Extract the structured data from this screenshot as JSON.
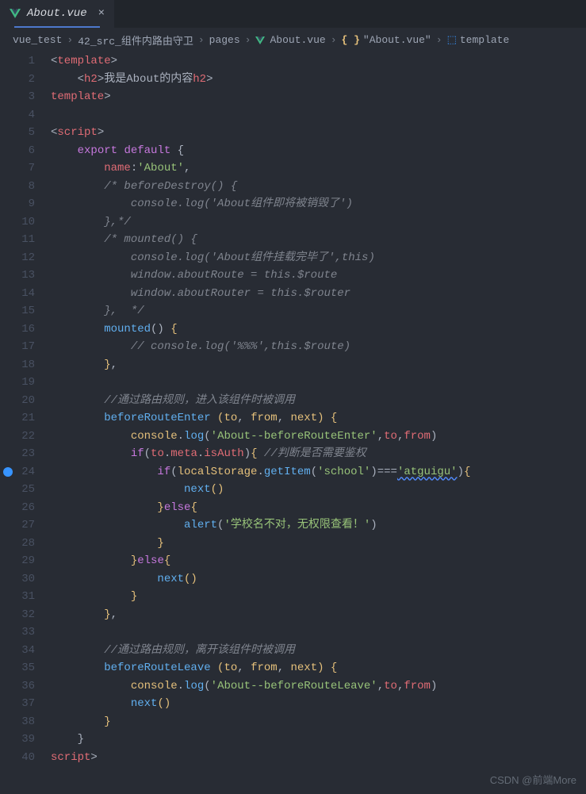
{
  "tab": {
    "filename": "About.vue",
    "icon": "vue-icon"
  },
  "breadcrumbs": {
    "items": [
      {
        "label": "vue_test"
      },
      {
        "label": "42_src_组件内路由守卫"
      },
      {
        "label": "pages"
      },
      {
        "label": "About.vue",
        "icon": "vue"
      },
      {
        "label": "\"About.vue\"",
        "icon": "brace"
      },
      {
        "label": "template",
        "icon": "tmpl"
      }
    ]
  },
  "lines": [
    1,
    2,
    3,
    4,
    5,
    6,
    7,
    8,
    9,
    10,
    11,
    12,
    13,
    14,
    15,
    16,
    17,
    18,
    19,
    20,
    21,
    22,
    23,
    24,
    25,
    26,
    27,
    28,
    29,
    30,
    31,
    32,
    33,
    34,
    35,
    36,
    37,
    38,
    39,
    40
  ],
  "info_marker_line": 24,
  "code": {
    "l1": {
      "open": "<",
      "tag": "template",
      "close": ">"
    },
    "l2": {
      "indent": "    ",
      "open": "<",
      "tag": "h2",
      "close": ">",
      "text": "我是About的内容",
      "open2": "</",
      "close2": ">"
    },
    "l3": {
      "open": "</",
      "tag": "template",
      "close": ">"
    },
    "l5": {
      "open": "<",
      "tag": "script",
      "close": ">"
    },
    "l6": {
      "kw": "export",
      "kw2": "default",
      "brace": " {"
    },
    "l7": {
      "prop": "name",
      "colon": ":",
      "str": "'About'",
      "comma": ","
    },
    "l8": "/* beforeDestroy() {",
    "l9": "    console.log('About组件即将被销毁了')",
    "l10": "},*/",
    "l11": "/* mounted() {",
    "l12": "    console.log('About组件挂载完毕了',this)",
    "l13": "    window.aboutRoute = this.$route",
    "l14": "    window.aboutRouter = this.$router",
    "l15": "},  */",
    "l16": {
      "fn": "mounted",
      "paren": "() ",
      "brace": "{"
    },
    "l17": "// console.log('%%%',this.$route)",
    "l18": "},",
    "l20": "//通过路由规则，进入该组件时被调用",
    "l21": {
      "fn": "beforeRouteEnter",
      "p1": "to",
      "p2": "from",
      "p3": "next"
    },
    "l22": {
      "obj": "console",
      "dot": ".",
      "fn": "log",
      "str": "'About--beforeRouteEnter'",
      "a2": "to",
      "a3": "from"
    },
    "l23": {
      "kw": "if",
      "obj": "to",
      "d1": ".",
      "p1": "meta",
      "d2": ".",
      "p2": "isAuth",
      "cmt": " //判断是否需要鉴权"
    },
    "l24": {
      "kw": "if",
      "obj": "localStorage",
      "fn": "getItem",
      "str": "'school'",
      "op": "===",
      "str2": "'atguigu'"
    },
    "l25": {
      "fn": "next"
    },
    "l26": {
      "brace": "}",
      "kw": "else",
      "brace2": "{"
    },
    "l27": {
      "fn": "alert",
      "str": "'学校名不对，无权限查看！'"
    },
    "l28": "}",
    "l29": {
      "brace": "}",
      "kw": "else",
      "brace2": "{"
    },
    "l30": {
      "fn": "next"
    },
    "l31": "}",
    "l32": "},",
    "l34": "//通过路由规则，离开该组件时被调用",
    "l35": {
      "fn": "beforeRouteLeave",
      "p1": "to",
      "p2": "from",
      "p3": "next"
    },
    "l36": {
      "obj": "console",
      "fn": "log",
      "str": "'About--beforeRouteLeave'",
      "a2": "to",
      "a3": "from"
    },
    "l37": {
      "fn": "next"
    },
    "l38": "}",
    "l39": "}",
    "l40": {
      "open": "</",
      "tag": "script",
      "close": ">"
    }
  },
  "watermark": "CSDN @前端More"
}
